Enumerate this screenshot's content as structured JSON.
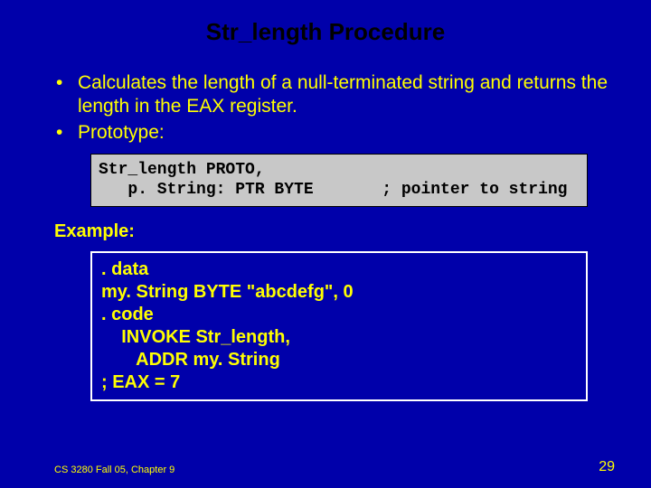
{
  "title": "Str_length Procedure",
  "bullets": [
    "Calculates the length of a null-terminated string and returns the length in the EAX register.",
    "Prototype:"
  ],
  "bullet_mark": "•",
  "proto_code": "Str_length PROTO,\n   p. String: PTR BYTE       ; pointer to string",
  "example_label": "Example:",
  "example_code": ". data\nmy. String BYTE \"abcdefg\", 0\n. code\n    INVOKE Str_length,\n       ADDR my. String\n; EAX = 7",
  "footer_left": "CS 3280 Fall 05, Chapter 9",
  "footer_right": "29"
}
